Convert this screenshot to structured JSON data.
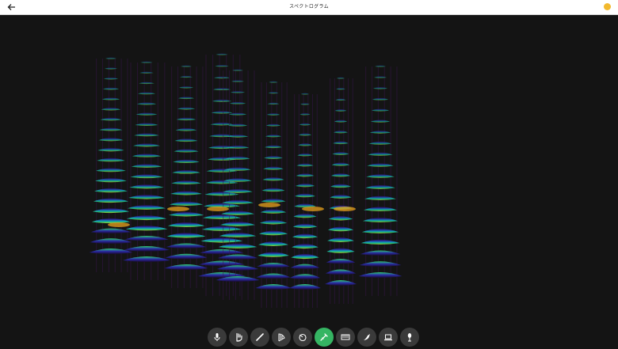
{
  "app": {
    "title": "スペクトログラム"
  },
  "header": {
    "back_icon": "back-arrow-icon",
    "help_icon": "help-icon",
    "accent_yellow": "#f2b92e"
  },
  "toolbar": {
    "active_color": "#35b563",
    "tools": [
      {
        "name": "mic-icon"
      },
      {
        "name": "hand-icon"
      },
      {
        "name": "flute-icon"
      },
      {
        "name": "harp-icon"
      },
      {
        "name": "drum-icon"
      },
      {
        "name": "trumpet-icon",
        "active": true
      },
      {
        "name": "keyboard-icon"
      },
      {
        "name": "bird-icon"
      },
      {
        "name": "laptop-icon"
      },
      {
        "name": "microphone-stand-icon"
      }
    ]
  },
  "visualization": {
    "type": "3d-spectrogram",
    "colors": [
      "#2a0f4a",
      "#2a2aa8",
      "#0fa7c7",
      "#2ecf6f",
      "#d8e02a",
      "#e8a21c"
    ]
  }
}
